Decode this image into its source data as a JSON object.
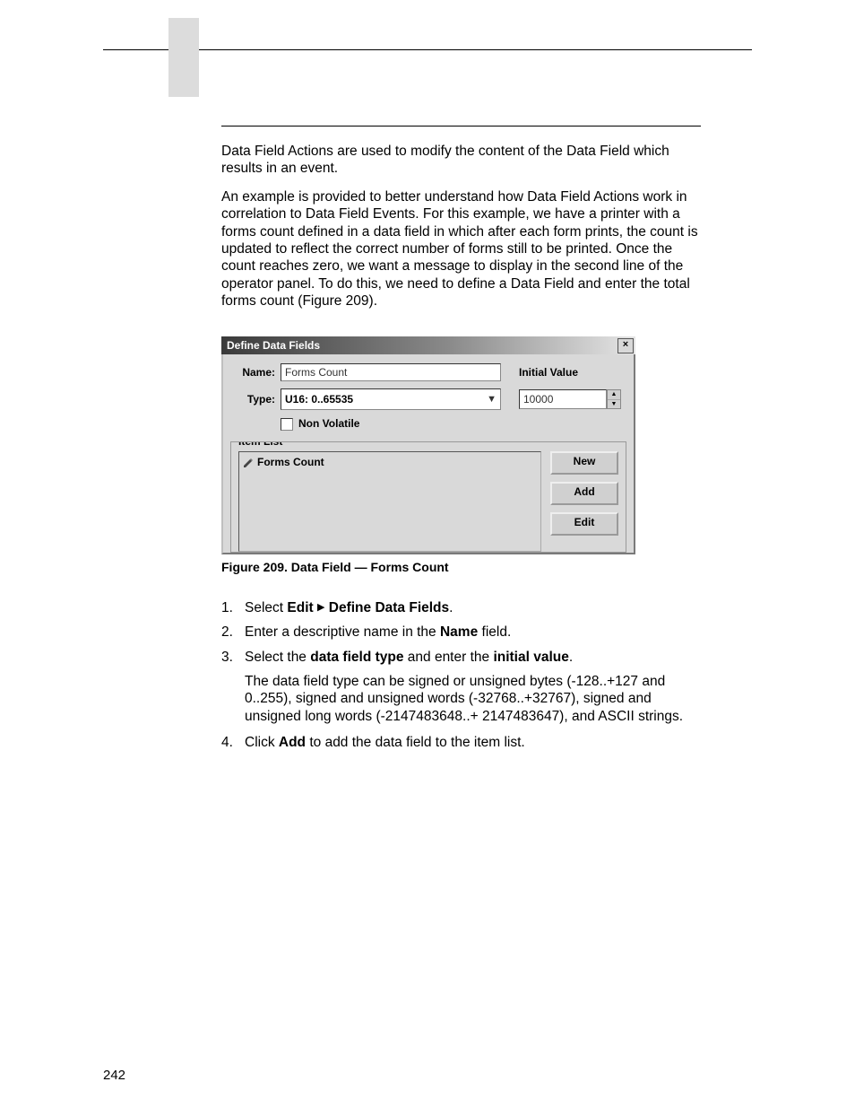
{
  "body": {
    "para1": "Data Field Actions are used to modify the content of the Data Field which results in an event.",
    "para2": "An example is provided to better understand how Data Field Actions work in correlation to Data Field Events. For this example, we have a printer with a forms count defined in a data field in which after each form prints, the count is updated to reflect the correct number of forms still to be printed. Once the count reaches zero, we want a message to display in the second line of the operator panel. To do this, we need to define a Data Field and enter the total forms count (Figure 209)."
  },
  "dialog": {
    "title": "Define Data Fields",
    "close_glyph": "×",
    "name_label": "Name:",
    "name_value": "Forms Count",
    "type_label": "Type:",
    "type_value": "U16: 0..65535",
    "initial_value_label": "Initial Value",
    "initial_value": "10000",
    "nonvolatile_label": "Non Volatile",
    "itemlist_label": "Item List",
    "list_item0": "Forms Count",
    "btn_new": "New",
    "btn_add": "Add",
    "btn_edit": "Edit"
  },
  "caption": "Figure 209. Data Field — Forms Count",
  "steps": {
    "s1_num": "1.",
    "s1_a": "Select ",
    "s1_b": "Edit",
    "s1_arrow": "▶",
    "s1_c": "Define Data Fields",
    "s1_d": ".",
    "s2_num": "2.",
    "s2_a": "Enter a descriptive name in the ",
    "s2_b": "Name",
    "s2_c": " field.",
    "s3_num": "3.",
    "s3_a": "Select the ",
    "s3_b": "data field type",
    "s3_c": " and enter the ",
    "s3_d": "initial value",
    "s3_e": ".",
    "s3_sub": "The data field type can be signed or unsigned bytes (-128..+127 and 0..255), signed and unsigned words (-32768..+32767), signed and unsigned long words (-2147483648..+ 2147483647), and ASCII strings.",
    "s4_num": "4.",
    "s4_a": "Click ",
    "s4_b": "Add",
    "s4_c": " to add the data field to the item list."
  },
  "page_number": "242"
}
